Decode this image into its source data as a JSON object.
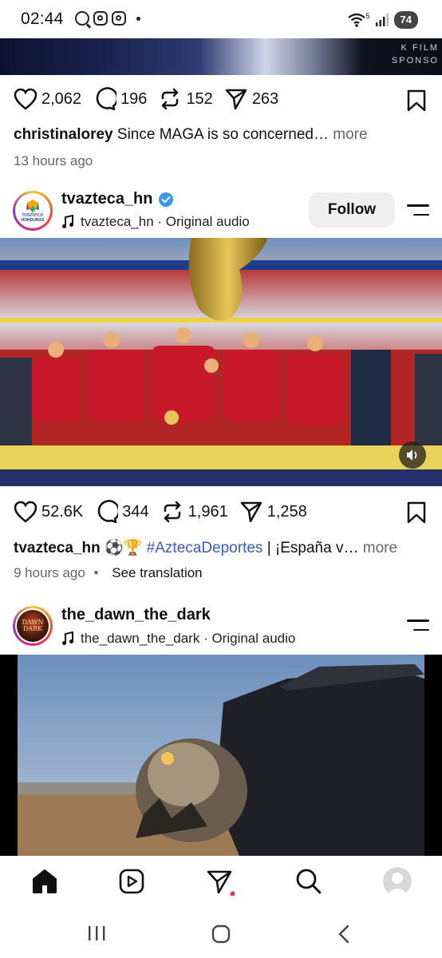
{
  "status_bar": {
    "time": "02:44",
    "battery": "74",
    "wifi_label": "5"
  },
  "top_image": {
    "tag_line1": "K FILM",
    "tag_line2": "SPONSO"
  },
  "post1": {
    "likes": "2,062",
    "comments": "196",
    "reposts": "152",
    "shares": "263",
    "caption_user": "christinalorey",
    "caption_text": "Since MAGA is so concerned…",
    "more_label": "more",
    "time_ago": "13 hours ago"
  },
  "post2": {
    "username": "tvazteca_hn",
    "verified": true,
    "audio": "tvazteca_hn · Original audio",
    "follow_label": "Follow",
    "avatar_text1": "tvazteca",
    "avatar_text2": "HONDURAS",
    "likes": "52.6K",
    "comments": "344",
    "reposts": "1,961",
    "shares": "1,258",
    "caption_user": "tvazteca_hn",
    "caption_emoji": "⚽🏆",
    "caption_hashtag": "#AztecaDeportes",
    "caption_text": "| ¡España v…",
    "more_label": "more",
    "time_ago": "9 hours ago",
    "translation_label": "See translation"
  },
  "post3": {
    "username": "the_dawn_the_dark",
    "audio": "the_dawn_the_dark · Original audio",
    "avatar_text1": "DAWN",
    "avatar_text2": "DARK"
  },
  "colors": {
    "accent_blue": "#3897f0",
    "hashtag": "#3b5db7",
    "notif_dot": "#ff3040"
  },
  "nav": [
    "home-icon",
    "reels-icon",
    "activity-icon",
    "search-icon",
    "profile-icon"
  ]
}
